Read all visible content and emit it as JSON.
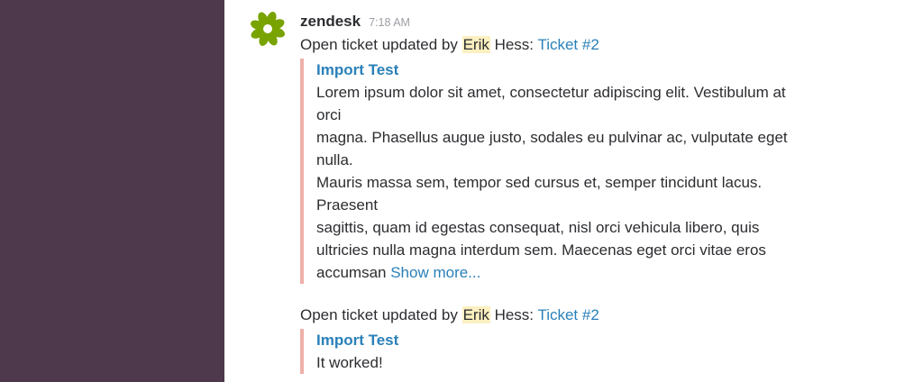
{
  "message": {
    "sender": "zendesk",
    "timestamp": "7:18 AM"
  },
  "update1": {
    "prefix": "Open ticket updated by ",
    "first_name": "Erik",
    "last_name_suffix": " Hess: ",
    "ticket_link": "Ticket #2",
    "attachment": {
      "title": "Import Test",
      "lines": [
        "Lorem ipsum dolor sit amet, consectetur adipiscing elit. Vestibulum at",
        "orci",
        "magna. Phasellus augue justo, sodales eu pulvinar ac, vulputate eget",
        "nulla.",
        "Mauris massa sem, tempor sed cursus et, semper tincidunt lacus.",
        "Praesent",
        "sagittis, quam id egestas consequat, nisl orci vehicula libero, quis",
        "ultricies nulla magna interdum sem. Maecenas eget orci vitae eros"
      ],
      "last_line": "accumsan ",
      "show_more": "Show more..."
    }
  },
  "update2": {
    "prefix": "Open ticket updated by ",
    "first_name": "Erik",
    "last_name_suffix": " Hess: ",
    "ticket_link": "Ticket #2",
    "attachment": {
      "title": "Import Test",
      "body": "It worked!"
    }
  },
  "colors": {
    "sidebar": "#4d394b",
    "link": "#2a80b9",
    "highlight": "#fcf0c0",
    "attachment_bar": "#eeb0a9",
    "logo_green": "#78a300"
  }
}
